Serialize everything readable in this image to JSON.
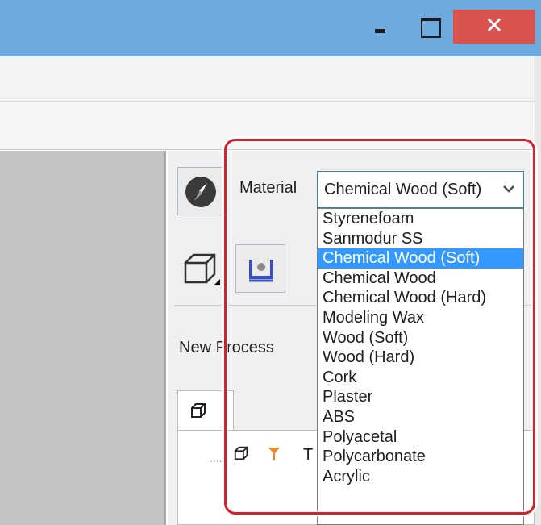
{
  "window": {
    "minimize_icon": "minimize-icon",
    "maximize_icon": "maximize-icon",
    "close_glyph": "✕",
    "titlebar_color": "#6faadf",
    "close_color": "#d9534f"
  },
  "panel": {
    "material_label": "Material",
    "material_value": "Chemical Wood (Soft)",
    "new_process_label": "New Process",
    "tree_text": "T",
    "material_options": [
      "Styrenefoam",
      "Sanmodur SS",
      "Chemical Wood (Soft)",
      "Chemical Wood",
      "Chemical Wood (Hard)",
      "Modeling Wax",
      "Wood (Soft)",
      "Wood (Hard)",
      "Cork",
      "Plaster",
      "ABS",
      "Polyacetal",
      "Polycarbonate",
      "Acrylic"
    ],
    "selected_index": 2
  },
  "annotation": {
    "highlight_color": "#d6212c"
  }
}
